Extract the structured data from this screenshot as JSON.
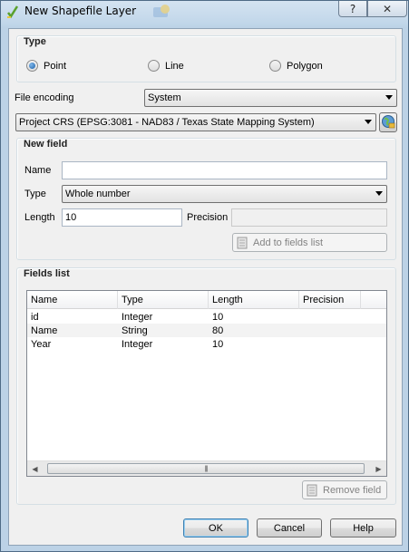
{
  "window": {
    "title": "New Shapefile Layer",
    "help_btn": "?",
    "close_btn": "✕"
  },
  "type_group": {
    "title": "Type",
    "options": [
      {
        "label": "Point",
        "checked": true
      },
      {
        "label": "Line",
        "checked": false
      },
      {
        "label": "Polygon",
        "checked": false
      }
    ]
  },
  "file_encoding": {
    "label": "File encoding",
    "value": "System"
  },
  "crs": {
    "value": "Project CRS (EPSG:3081 - NAD83 / Texas State Mapping System)"
  },
  "new_field": {
    "title": "New field",
    "name_label": "Name",
    "name_value": "",
    "type_label": "Type",
    "type_value": "Whole number",
    "length_label": "Length",
    "length_value": "10",
    "precision_label": "Precision",
    "precision_value": "",
    "add_button": "Add to fields list"
  },
  "fields_list": {
    "title": "Fields list",
    "columns": [
      "Name",
      "Type",
      "Length",
      "Precision"
    ],
    "rows": [
      [
        "id",
        "Integer",
        "10",
        ""
      ],
      [
        "Name",
        "String",
        "80",
        ""
      ],
      [
        "Year",
        "Integer",
        "10",
        ""
      ]
    ],
    "remove_button": "Remove field"
  },
  "footer": {
    "ok": "OK",
    "cancel": "Cancel",
    "help": "Help"
  }
}
